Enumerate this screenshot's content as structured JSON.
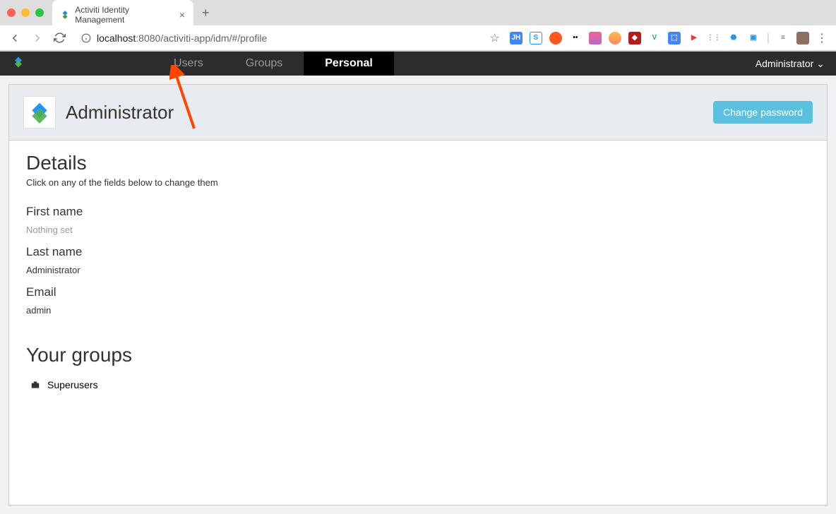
{
  "browser": {
    "tab_title": "Activiti Identity Management",
    "url_host": "localhost",
    "url_port": ":8080",
    "url_path": "/activiti-app/idm/#/profile"
  },
  "navbar": {
    "tabs": {
      "users": "Users",
      "groups": "Groups",
      "personal": "Personal"
    },
    "user_label": "Administrator"
  },
  "header": {
    "title": "Administrator",
    "change_password_label": "Change password"
  },
  "details": {
    "section_title": "Details",
    "section_hint": "Click on any of the fields below to change them",
    "first_name_label": "First name",
    "first_name_value": "Nothing set",
    "last_name_label": "Last name",
    "last_name_value": "Administrator",
    "email_label": "Email",
    "email_value": "admin"
  },
  "groups": {
    "section_title": "Your groups",
    "items": [
      {
        "name": "Superusers"
      }
    ]
  }
}
